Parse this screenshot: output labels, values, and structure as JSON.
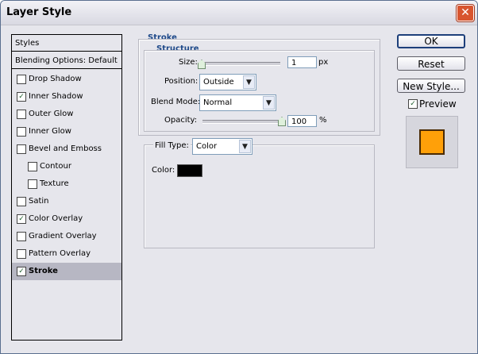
{
  "window": {
    "title": "Layer Style"
  },
  "styles_panel": {
    "header": "Styles",
    "blending_options": "Blending Options: Default",
    "items": [
      {
        "label": "Drop Shadow",
        "checked": false,
        "indent": false,
        "active": false
      },
      {
        "label": "Inner Shadow",
        "checked": true,
        "indent": false,
        "active": false
      },
      {
        "label": "Outer Glow",
        "checked": false,
        "indent": false,
        "active": false
      },
      {
        "label": "Inner Glow",
        "checked": false,
        "indent": false,
        "active": false
      },
      {
        "label": "Bevel and Emboss",
        "checked": false,
        "indent": false,
        "active": false
      },
      {
        "label": "Contour",
        "checked": false,
        "indent": true,
        "active": false
      },
      {
        "label": "Texture",
        "checked": false,
        "indent": true,
        "active": false
      },
      {
        "label": "Satin",
        "checked": false,
        "indent": false,
        "active": false
      },
      {
        "label": "Color Overlay",
        "checked": true,
        "indent": false,
        "active": false
      },
      {
        "label": "Gradient Overlay",
        "checked": false,
        "indent": false,
        "active": false
      },
      {
        "label": "Pattern Overlay",
        "checked": false,
        "indent": false,
        "active": false
      },
      {
        "label": "Stroke",
        "checked": true,
        "indent": false,
        "active": true
      }
    ]
  },
  "stroke": {
    "section_title": "Stroke",
    "structure_title": "Structure",
    "size": {
      "label": "Size:",
      "value": "1",
      "unit": "px",
      "slider_fraction": 0.0
    },
    "position": {
      "label": "Position:",
      "value": "Outside"
    },
    "blend_mode": {
      "label": "Blend Mode:",
      "value": "Normal"
    },
    "opacity": {
      "label": "Opacity:",
      "value": "100",
      "unit": "%",
      "slider_fraction": 1.0
    },
    "fill_type": {
      "label": "Fill Type:",
      "value": "Color"
    },
    "color": {
      "label": "Color:",
      "swatch": "#000000"
    }
  },
  "buttons": {
    "ok": "OK",
    "reset": "Reset",
    "new_style": "New Style...",
    "preview_label": "Preview",
    "preview_checked": true
  },
  "preview": {
    "swatch_color": "#ffa009"
  },
  "icons": {
    "close": "close-icon",
    "dropdown": "chevron-down-icon",
    "check": "check-icon"
  }
}
